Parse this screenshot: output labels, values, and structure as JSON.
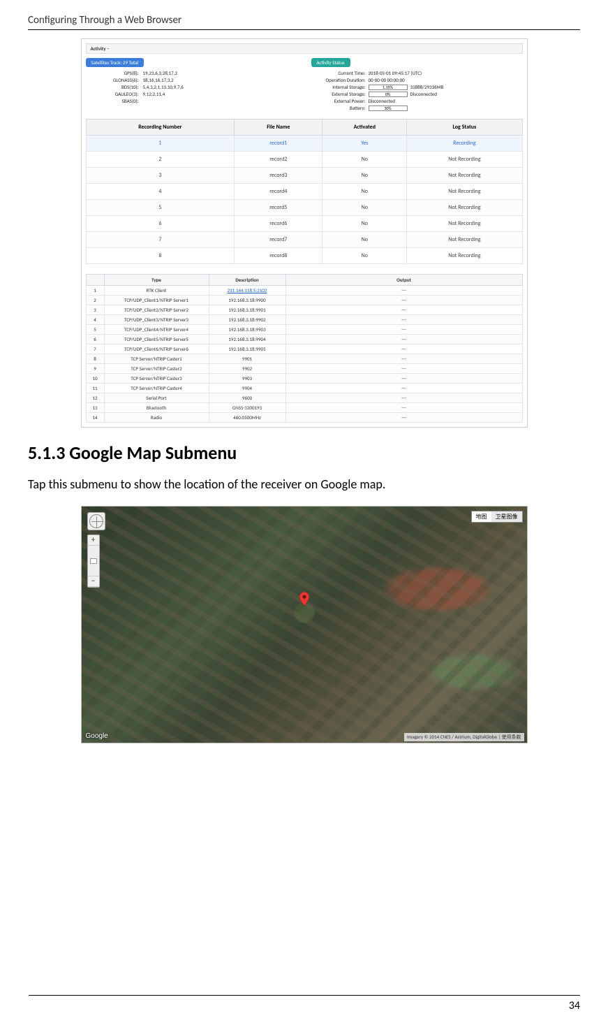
{
  "header": {
    "title": "Configuring Through a Web Browser"
  },
  "screenshot1": {
    "activity_label": "Activity –",
    "sat_badge": "Satellites Track:  29 Total",
    "satellites": [
      {
        "label": "GPS(8):",
        "val": "19,23,6,3,28,17,2"
      },
      {
        "label": "GLONASS(6):",
        "val": "18,16,16,17,3,2"
      },
      {
        "label": "BDS(10):",
        "val": "5,4,3,2,1,13,10,9,7,6"
      },
      {
        "label": "GALILEO(3):",
        "val": "9,12,2,11,4"
      },
      {
        "label": "SBAS(0):",
        "val": ""
      }
    ],
    "status_badge": "Activity Status",
    "status": {
      "current_time_label": "Current Time:",
      "current_time": "2018-05-01 09:45:17 (UTC)",
      "op_dur_label": "Operation Duration:",
      "op_dur": "00-00-00 00:00:00",
      "int_storage_label": "Internal Storage:",
      "int_storage_pct": "1.15%",
      "int_storage_note": "33888/29336MB",
      "ext_storage_label": "External Storage:",
      "ext_storage_pct": "0%",
      "ext_storage_note": "Disconnected",
      "ext_power_label": "External Power:",
      "ext_power": "Disconnected",
      "battery_label": "Battery:",
      "battery_pct": "30%"
    },
    "rec_headers": [
      "Recording Number",
      "File Name",
      "Activated",
      "Log Status"
    ],
    "rec_rows": [
      {
        "n": "1",
        "f": "record1",
        "a": "Yes",
        "s": "Recording",
        "hl": true
      },
      {
        "n": "2",
        "f": "record2",
        "a": "No",
        "s": "Not Recording"
      },
      {
        "n": "3",
        "f": "record3",
        "a": "No",
        "s": "Not Recording"
      },
      {
        "n": "4",
        "f": "record4",
        "a": "No",
        "s": "Not Recording"
      },
      {
        "n": "5",
        "f": "record5",
        "a": "No",
        "s": "Not Recording"
      },
      {
        "n": "6",
        "f": "record6",
        "a": "No",
        "s": "Not Recording"
      },
      {
        "n": "7",
        "f": "record7",
        "a": "No",
        "s": "Not Recording"
      },
      {
        "n": "8",
        "f": "record8",
        "a": "No",
        "s": "Not Recording"
      }
    ],
    "io_headers": [
      "",
      "Type",
      "Description",
      "Output"
    ],
    "io_rows": [
      {
        "n": "1",
        "t": "RTK Client",
        "d": "211.144.118.5:2102",
        "o": "---",
        "link": true
      },
      {
        "n": "2",
        "t": "TCP/UDP_Client1/NTRIP Server1",
        "d": "192.168.3.18:9900",
        "o": "---"
      },
      {
        "n": "3",
        "t": "TCP/UDP_Client2/NTRIP Server2",
        "d": "192.168.3.18:9901",
        "o": "---"
      },
      {
        "n": "4",
        "t": "TCP/UDP_Client3/NTRIP Server3",
        "d": "192.168.3.18:9902",
        "o": "---"
      },
      {
        "n": "5",
        "t": "TCP/UDP_Client4/NTRIP Server4",
        "d": "192.168.3.18:9903",
        "o": "---"
      },
      {
        "n": "6",
        "t": "TCP/UDP_Client5/NTRIP Server5",
        "d": "192.168.3.18:9904",
        "o": "---"
      },
      {
        "n": "7",
        "t": "TCP/UDP_Client6/NTRIP Server6",
        "d": "192.168.3.18:9905",
        "o": "---"
      },
      {
        "n": "8",
        "t": "TCP Server/NTRIP Caster1",
        "d": "9901",
        "o": "---"
      },
      {
        "n": "9",
        "t": "TCP Server/NTRIP Caster2",
        "d": "9902",
        "o": "---"
      },
      {
        "n": "10",
        "t": "TCP Server/NTRIP Caster3",
        "d": "9903",
        "o": "---"
      },
      {
        "n": "11",
        "t": "TCP Server/NTRIP Caster4",
        "d": "9904",
        "o": "---"
      },
      {
        "n": "12",
        "t": "Serial Port",
        "d": "9600",
        "o": "---"
      },
      {
        "n": "13",
        "t": "Bluetooth",
        "d": "GNSS-3200193",
        "o": "---"
      },
      {
        "n": "14",
        "t": "Radio",
        "d": "460.0500MHz",
        "o": "---"
      }
    ]
  },
  "section": {
    "heading": "5.1.3 Google Map Submenu",
    "body": "Tap this submenu to show the location of the receiver on Google map."
  },
  "map": {
    "type_a": "地图",
    "type_b": "卫星图像",
    "logo": "Google",
    "attrib": "Imagery © 2014 CNES / Astrium, DigitalGlobe | 使用条款"
  },
  "page_number": "34"
}
